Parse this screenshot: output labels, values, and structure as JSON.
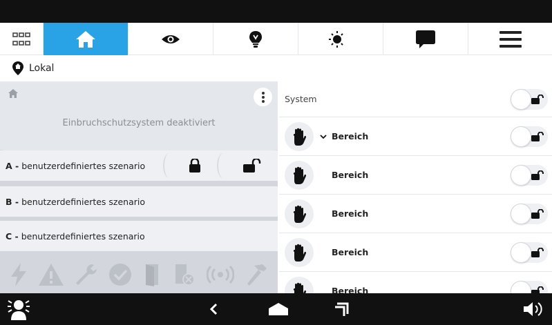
{
  "nav": {
    "items": [
      {
        "icon": "grid-icon"
      },
      {
        "icon": "home-icon",
        "active": true
      },
      {
        "icon": "eye-icon"
      },
      {
        "icon": "bulb-icon"
      },
      {
        "icon": "sun-moon-icon"
      },
      {
        "icon": "chat-icon"
      },
      {
        "icon": "menu-icon"
      }
    ],
    "accent": "#2aa3e6"
  },
  "location": {
    "label": "Lokal"
  },
  "alarm": {
    "status": "Einbruchschutzsystem deaktiviert",
    "scenarios": [
      {
        "key": "A -",
        "label": "benutzerdefiniertes szenario"
      },
      {
        "key": "B -",
        "label": "benutzerdefiniertes szenario"
      },
      {
        "key": "C -",
        "label": "benutzerdefiniertes szenario"
      }
    ],
    "status_icons": [
      "lightning-icon",
      "warning-icon",
      "wrench-icon",
      "check-icon",
      "door-icon",
      "door-blocked-icon",
      "signal-icon",
      "hammer-icon"
    ]
  },
  "right": {
    "system_label": "System",
    "areas": [
      {
        "label": "Bereich",
        "expanded": true
      },
      {
        "label": "Bereich"
      },
      {
        "label": "Bereich"
      },
      {
        "label": "Bereich"
      },
      {
        "label": "Bereich"
      }
    ]
  }
}
